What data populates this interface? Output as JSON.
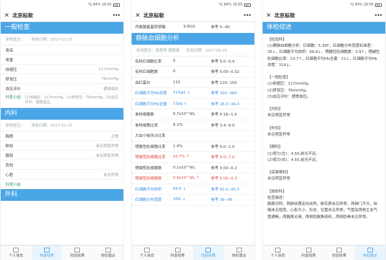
{
  "status": {
    "left": "",
    "right": "⁵G 84% 16:55"
  },
  "title": "北京标软",
  "close_icon": "close-icon",
  "more_icon": "more-dots-icon",
  "tabs": [
    "个人信息",
    "科室结果",
    "检验结果",
    "体检建议"
  ],
  "panel1": {
    "section1": "一般检查",
    "doctor_label": "审核医生：",
    "date_label": "审核日期：2017-02-25",
    "rows": [
      {
        "label": "身高",
        "value": ""
      },
      {
        "label": "体重",
        "value": ""
      },
      {
        "label": "收缩压",
        "value": "117mmHg"
      },
      {
        "label": "舒张压",
        "value": "76mmHg"
      },
      {
        "label": "血压评价",
        "value": "理想血压"
      }
    ],
    "summary_label": "科室小结",
    "summary_text": "(1)收缩压：117mmHg。(2)舒张压：76mmHg。(3)血压评价：理想血压。",
    "section2": "内科",
    "doctor_label2": "审核医生：",
    "date_label2": "审核日期：2017-02-25",
    "rows2": [
      {
        "label": "胸廓",
        "value": "正常"
      },
      {
        "label": "肺部",
        "value": "未见明显异常"
      },
      {
        "label": "腹部",
        "value": "未见明显异常"
      },
      {
        "label": "其他",
        "value": ""
      },
      {
        "label": "心脏",
        "value": "未见异常"
      }
    ],
    "summary_label2": "科室小结",
    "section3": "外科"
  },
  "panel2": {
    "top_row": {
      "name": "丙氨酸氨基转移酶",
      "value": "9.8U/L",
      "ref": "参考 5--40"
    },
    "section": "静脉血细胞分析",
    "doctor_label": "检验医生：庞慧琴 德蕾娟",
    "date_label": "检验日期：2017-02-25",
    "rows": [
      {
        "name": "有核红细胞比率",
        "value": "0",
        "ref": "参考 0.0--0.4",
        "flag": ""
      },
      {
        "name": "有核红细胞数",
        "value": "0",
        "ref": "参考 0.00--0.02",
        "flag": ""
      },
      {
        "name": "血红蛋白",
        "value": "113",
        "ref": "参考 110--150",
        "flag": ""
      },
      {
        "name": "红细胞平均Hb浓度",
        "value": "314g/L ↓",
        "ref": "参考 320--360",
        "flag": "blue"
      },
      {
        "name": "红细胞平均Hb含量",
        "value": "21pg ↓",
        "ref": "参考 26.0--34.0",
        "flag": "blue"
      },
      {
        "name": "单核细胞数",
        "value": "0.7x10^9/L",
        "ref": "参考 0.16--1.0",
        "flag": ""
      },
      {
        "name": "单核细胞比率",
        "value": "8.1%",
        "ref": "参考 3.4--9.0",
        "flag": ""
      },
      {
        "name": "大血小板所占比率",
        "value": "",
        "ref": "",
        "flag": ""
      },
      {
        "name": "嗜酸性粒细胞比率",
        "value": "1.4%",
        "ref": "参考 0.0--1.5",
        "flag": ""
      },
      {
        "name": "嗜碱性粒细胞比率",
        "value": "10.7% ↑",
        "ref": "参考 0.0--7.0",
        "flag": "red"
      },
      {
        "name": "嗜碱性粒细胞数",
        "value": "0.1x10^9/L",
        "ref": "参考 0.00--0.2",
        "flag": ""
      },
      {
        "name": "嗜碱性粒细胞数",
        "value": "0.9x10^9/L ↑",
        "ref": "参考 0.05--0.3",
        "flag": "red"
      },
      {
        "name": "红细胞平均体积",
        "value": "66.8 ↓",
        "ref": "参考 82.0--95.0",
        "flag": "blue"
      },
      {
        "name": "红细胞分布宽度",
        "value": "35fL ↓",
        "ref": "参考 36--48",
        "flag": "blue"
      }
    ]
  },
  "panel3": {
    "section": "体检综述",
    "text": "【检验科】\n(1)静脉血细胞分析：红细胞：5.39T，红细胞分布宽度标准差：35↓，红细胞平均体积：66.8↓，嗜酸性粒细胞数：0.9↑，嗜碱性粒细胞比率：10.7↑，红细胞平均Hb含量：21↓，红细胞平均Hb浓度：314↓。\n\n【一般检查】\n(1)收缩压：117mmHg。\n(2)舒张压：76mmHg。\n(3)血压评价：理想血压。\n\n【内科】\n未见明显异常\n\n【外科】\n未见明显异常\n\n【眼科】\n(1)视力(左)：4.50,前光不足。\n(2)视力(右)：4.50,前光不足。\n\n【耳鼻喉科】\n未见明显异常\n\n【放射科】\n检查描述：\n胸廓对称，两肺纹理走向自然，肺实质未见异常，两肺门不大，纵隔未见增宽，心影大小、形态、位置未见异常，气管及两侧主支气管通畅，两膈面光滑，两侧肋膈角锐利，两侧肋骨未见异常。"
  }
}
